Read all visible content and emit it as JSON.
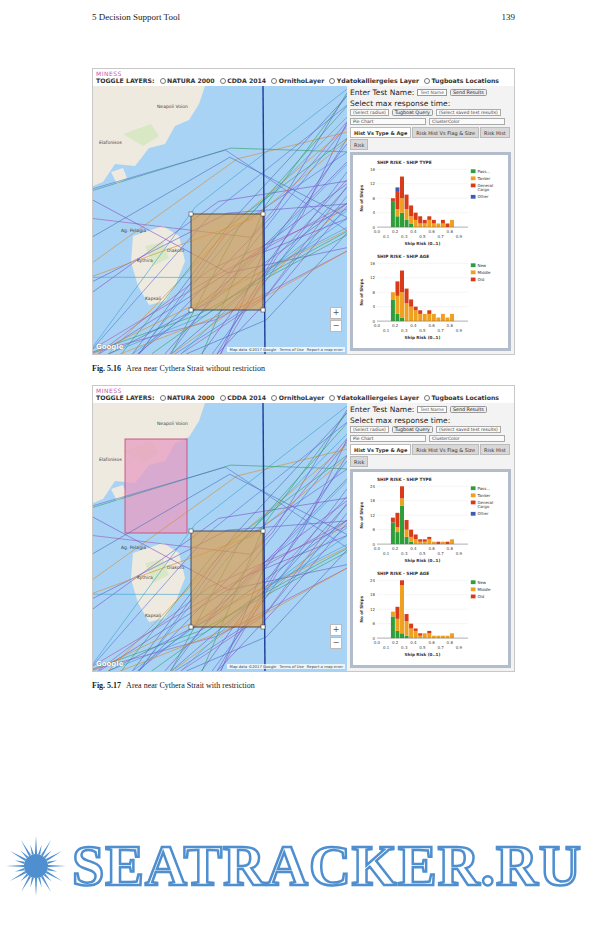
{
  "page_header": {
    "section": "5 Decision Support Tool",
    "page_number": "139"
  },
  "figures": [
    {
      "screenshot": {
        "logo": "MINESS",
        "toggle_label": "TOGGLE LAYERS:",
        "layers": [
          {
            "label": "NATURA 2000",
            "checked": false
          },
          {
            "label": "CDDA 2014",
            "checked": false
          },
          {
            "label": "OrnithoLayer",
            "checked": false
          },
          {
            "label": "Ydatokalliergeies Layer",
            "checked": false
          },
          {
            "label": "Tugboats Locations",
            "checked": false
          }
        ],
        "map": {
          "labels": [
            "Neapoli Voion",
            "Elafonisos",
            "Kythira",
            "Ag. Pelagia",
            "Diakofti",
            "Kapsali"
          ],
          "zoom_in": "+",
          "zoom_out": "−",
          "google": "Google",
          "attribution": "Map data ©2017 Google",
          "terms": "Terms of Use",
          "report": "Report a map error",
          "restricted_area": false
        },
        "panel": {
          "test_name_label": "Enter Test Name:",
          "test_name_value": "Test Name",
          "send_button": "Send Results",
          "response_label": "Select max response time:",
          "saved_select": "(Select saved test results)",
          "radius_select": "(Select radius)",
          "tugboat_button": "Tugboat Query",
          "chart_select": "Pie Chart",
          "color_select": "ClusterColor",
          "tabs": [
            {
              "label": "Hist Vs Type & Age",
              "selected": true
            },
            {
              "label": "Risk Hist Vs Flag & Size",
              "selected": false
            },
            {
              "label": "Risk Hist",
              "selected": false
            },
            {
              "label": "Risk",
              "selected": false
            }
          ]
        },
        "charts": [
          {
            "title": "SHIP RISK - SHIP TYPE",
            "y_label": "No of Ships",
            "x_label": "Ship Risk (0..1)",
            "y_max": 16,
            "y_ticks": [
              "0",
              "4",
              "8",
              "12",
              "16"
            ],
            "x_ticks_upper": [
              "0.0",
              "0.2",
              "0.4",
              "0.6",
              "0.8"
            ],
            "x_ticks_lower": [
              "0.1",
              "0.3",
              "0.5",
              "0.7",
              "0.9"
            ],
            "series": [
              {
                "name": "Pass...",
                "color": "#2e9e3a",
                "values": [
                  7,
                  3,
                  4,
                  2,
                  1,
                  0,
                  0,
                  0,
                  0,
                  0,
                  0,
                  0,
                  0,
                  0,
                  0
                ]
              },
              {
                "name": "Tanker",
                "color": "#f0a020",
                "values": [
                  0,
                  2,
                  4,
                  3,
                  2,
                  2,
                  1,
                  1,
                  2,
                  1,
                  1,
                  1,
                  0,
                  2,
                  0
                ]
              },
              {
                "name": "General Cargo",
                "color": "#d93a1a",
                "values": [
                  1,
                  5,
                  6,
                  4,
                  3,
                  2,
                  2,
                  1,
                  1,
                  1,
                  0,
                  1,
                  1,
                  0,
                  0
                ]
              },
              {
                "name": "Other",
                "color": "#3b5bb5",
                "values": [
                  0,
                  1,
                  0,
                  0,
                  0,
                  0,
                  0,
                  0,
                  0,
                  0,
                  0,
                  0,
                  0,
                  0,
                  0
                ]
              }
            ]
          },
          {
            "title": "SHIP RISK - SHIP AGE",
            "y_label": "No of Ships",
            "x_label": "Ship Risk (0..1)",
            "y_max": 16,
            "y_ticks": [
              "0",
              "4",
              "8",
              "12",
              "16"
            ],
            "x_ticks_upper": [
              "0.0",
              "0.2",
              "0.4",
              "0.6",
              "0.8"
            ],
            "x_ticks_lower": [
              "0.1",
              "0.3",
              "0.5",
              "0.7",
              "0.9"
            ],
            "series": [
              {
                "name": "New",
                "color": "#2e9e3a",
                "values": [
                  6,
                  2,
                  1,
                  0,
                  0,
                  0,
                  0,
                  0,
                  0,
                  0,
                  0,
                  0,
                  0,
                  0,
                  0
                ]
              },
              {
                "name": "Middle",
                "color": "#f0a020",
                "values": [
                  2,
                  5,
                  7,
                  5,
                  4,
                  3,
                  2,
                  2,
                  2,
                  2,
                  1,
                  2,
                  1,
                  2,
                  0
                ]
              },
              {
                "name": "Old",
                "color": "#d93a1a",
                "values": [
                  0,
                  4,
                  6,
                  4,
                  2,
                  1,
                  1,
                  0,
                  1,
                  0,
                  0,
                  0,
                  0,
                  0,
                  0
                ]
              }
            ]
          }
        ]
      },
      "caption": {
        "label": "Fig. 5.16",
        "text": "Area near Cythera Strait without restriction"
      }
    },
    {
      "screenshot": {
        "logo": "MINESS",
        "toggle_label": "TOGGLE LAYERS:",
        "layers": [
          {
            "label": "NATURA 2000",
            "checked": false
          },
          {
            "label": "CDDA 2014",
            "checked": false
          },
          {
            "label": "OrnithoLayer",
            "checked": false
          },
          {
            "label": "Ydatokalliergeies Layer",
            "checked": false
          },
          {
            "label": "Tugboats Locations",
            "checked": false
          }
        ],
        "map": {
          "labels": [
            "Neapoli Voion",
            "Elafonisos",
            "Kythira",
            "Ag. Pelagia",
            "Diakofti",
            "Kapsali"
          ],
          "zoom_in": "+",
          "zoom_out": "−",
          "google": "Google",
          "attribution": "Map data ©2017 Google",
          "terms": "Terms of Use",
          "report": "Report a map error",
          "restricted_area": true
        },
        "panel": {
          "test_name_label": "Enter Test Name:",
          "test_name_value": "Test Name",
          "send_button": "Send Results",
          "response_label": "Select max response time:",
          "saved_select": "(Select saved test results)",
          "radius_select": "(Select radius)",
          "tugboat_button": "Tugboat Query",
          "chart_select": "Pie Chart",
          "color_select": "ClusterColor",
          "tabs": [
            {
              "label": "Hist Vs Type & Age",
              "selected": true
            },
            {
              "label": "Risk Hist Vs Flag & Size",
              "selected": false
            },
            {
              "label": "Risk Hist",
              "selected": false
            },
            {
              "label": "Risk",
              "selected": false
            }
          ]
        },
        "charts": [
          {
            "title": "SHIP RISK - SHIP TYPE",
            "y_label": "No of Ships",
            "x_label": "Ship Risk (0..1)",
            "y_max": 24,
            "y_ticks": [
              "0",
              "6",
              "12",
              "18",
              "24"
            ],
            "x_ticks_upper": [
              "0.0",
              "0.2",
              "0.4",
              "0.6",
              "0.8"
            ],
            "x_ticks_lower": [
              "0.1",
              "0.3",
              "0.5",
              "0.7",
              "0.9"
            ],
            "series": [
              {
                "name": "Pass...",
                "color": "#2e9e3a",
                "values": [
                  9,
                  5,
                  16,
                  3,
                  1,
                  0,
                  0,
                  0,
                  0,
                  0,
                  0,
                  0,
                  0,
                  0,
                  0
                ]
              },
              {
                "name": "Tanker",
                "color": "#f0a020",
                "values": [
                  0,
                  2,
                  3,
                  3,
                  2,
                  2,
                  1,
                  1,
                  2,
                  1,
                  0,
                  1,
                  0,
                  2,
                  0
                ]
              },
              {
                "name": "General Cargo",
                "color": "#d93a1a",
                "values": [
                  2,
                  6,
                  5,
                  4,
                  3,
                  2,
                  1,
                  1,
                  1,
                  0,
                  1,
                  0,
                  1,
                  0,
                  0
                ]
              },
              {
                "name": "Other",
                "color": "#3b5bb5",
                "values": [
                  0,
                  0,
                  0,
                  0,
                  0,
                  0,
                  0,
                  0,
                  0,
                  0,
                  0,
                  0,
                  0,
                  0,
                  0
                ]
              }
            ]
          },
          {
            "title": "SHIP RISK - SHIP AGE",
            "y_label": "No of Ships",
            "x_label": "Ship Risk (0..1)",
            "y_max": 24,
            "y_ticks": [
              "0",
              "6",
              "12",
              "18",
              "24"
            ],
            "x_ticks_upper": [
              "0.0",
              "0.2",
              "0.4",
              "0.6",
              "0.8"
            ],
            "x_ticks_lower": [
              "0.1",
              "0.3",
              "0.5",
              "0.7",
              "0.9"
            ],
            "series": [
              {
                "name": "New",
                "color": "#2e9e3a",
                "values": [
                  9,
                  3,
                  2,
                  1,
                  0,
                  0,
                  0,
                  0,
                  0,
                  0,
                  0,
                  0,
                  0,
                  0,
                  0
                ]
              },
              {
                "name": "Middle",
                "color": "#f0a020",
                "values": [
                  2,
                  5,
                  20,
                  6,
                  4,
                  3,
                  1,
                  2,
                  2,
                  1,
                  1,
                  1,
                  1,
                  2,
                  0
                ]
              },
              {
                "name": "Old",
                "color": "#d93a1a",
                "values": [
                  0,
                  5,
                  2,
                  3,
                  2,
                  1,
                  1,
                  0,
                  1,
                  0,
                  0,
                  0,
                  0,
                  0,
                  0
                ]
              }
            ]
          }
        ]
      },
      "caption": {
        "label": "Fig. 5.17",
        "text": "Area near Cythera Strait with restriction"
      }
    }
  ],
  "footer_logo": {
    "text": "SEATRACKER.RU"
  }
}
